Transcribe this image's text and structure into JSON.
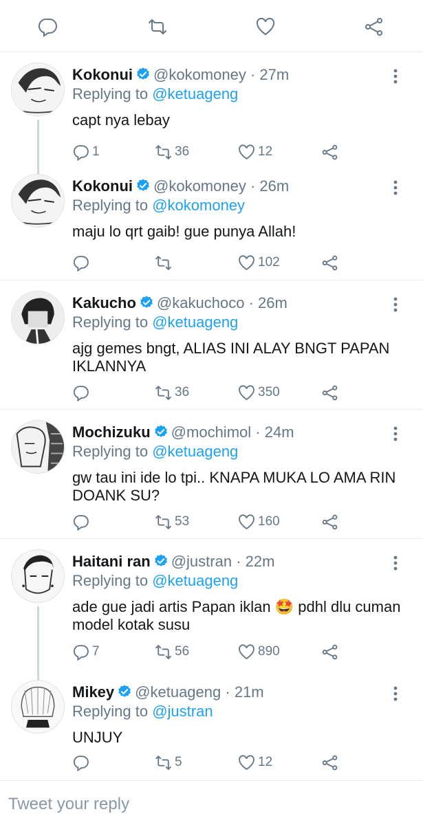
{
  "top_actions": [
    {
      "name": "reply-icon",
      "icon": "speech-bubble"
    },
    {
      "name": "retweet-icon",
      "icon": "retweet-arrows"
    },
    {
      "name": "like-icon",
      "icon": "heart"
    },
    {
      "name": "share-icon",
      "icon": "share-nodes"
    }
  ],
  "colors": {
    "text": "#14171a",
    "muted": "#657786",
    "link": "#1da1f2",
    "border": "#e6ecf0",
    "verified": "#1da1f2"
  },
  "tweets": [
    {
      "name": "Kokonui",
      "handle": "@kokomoney",
      "dot": "·",
      "time": "27m",
      "reply_prefix": "Replying to",
      "reply_to": "@ketuageng",
      "text": "capt nya lebay",
      "replies": "1",
      "retweets": "36",
      "likes": "12"
    },
    {
      "name": "Kokonui",
      "handle": "@kokomoney",
      "dot": "·",
      "time": "26m",
      "reply_prefix": "Replying to",
      "reply_to": "@kokomoney",
      "text": "maju lo qrt gaib! gue punya Allah!",
      "replies": "",
      "retweets": "",
      "likes": "102"
    },
    {
      "name": "Kakucho",
      "handle": "@kakuchoco",
      "dot": "·",
      "time": "26m",
      "reply_prefix": "Replying to",
      "reply_to": "@ketuageng",
      "text": "ajg gemes bngt, ALIAS INI ALAY BNGT PAPAN IKLANNYA",
      "replies": "",
      "retweets": "36",
      "likes": "350"
    },
    {
      "name": "Mochizuku",
      "handle": "@mochimol",
      "dot": "·",
      "time": "24m",
      "reply_prefix": "Replying to",
      "reply_to": "@ketuageng",
      "text": "gw tau ini ide lo tpi.. KNAPA MUKA LO AMA RIN DOANK SU?",
      "replies": "",
      "retweets": "53",
      "likes": "160"
    },
    {
      "name": "Haitani ran",
      "handle": "@justran",
      "dot": "·",
      "time": "22m",
      "reply_prefix": "Replying to",
      "reply_to": "@ketuageng",
      "text": "ade gue jadi artis Papan iklan 🤩 pdhl dlu cuman model kotak susu",
      "replies": "7",
      "retweets": "56",
      "likes": "890"
    },
    {
      "name": "Mikey",
      "handle": "@ketuageng",
      "dot": "·",
      "time": "21m",
      "reply_prefix": "Replying to",
      "reply_to": "@justran",
      "text": "UNJUY",
      "replies": "",
      "retweets": "5",
      "likes": "12"
    }
  ],
  "compose": {
    "placeholder": "Tweet your reply"
  }
}
